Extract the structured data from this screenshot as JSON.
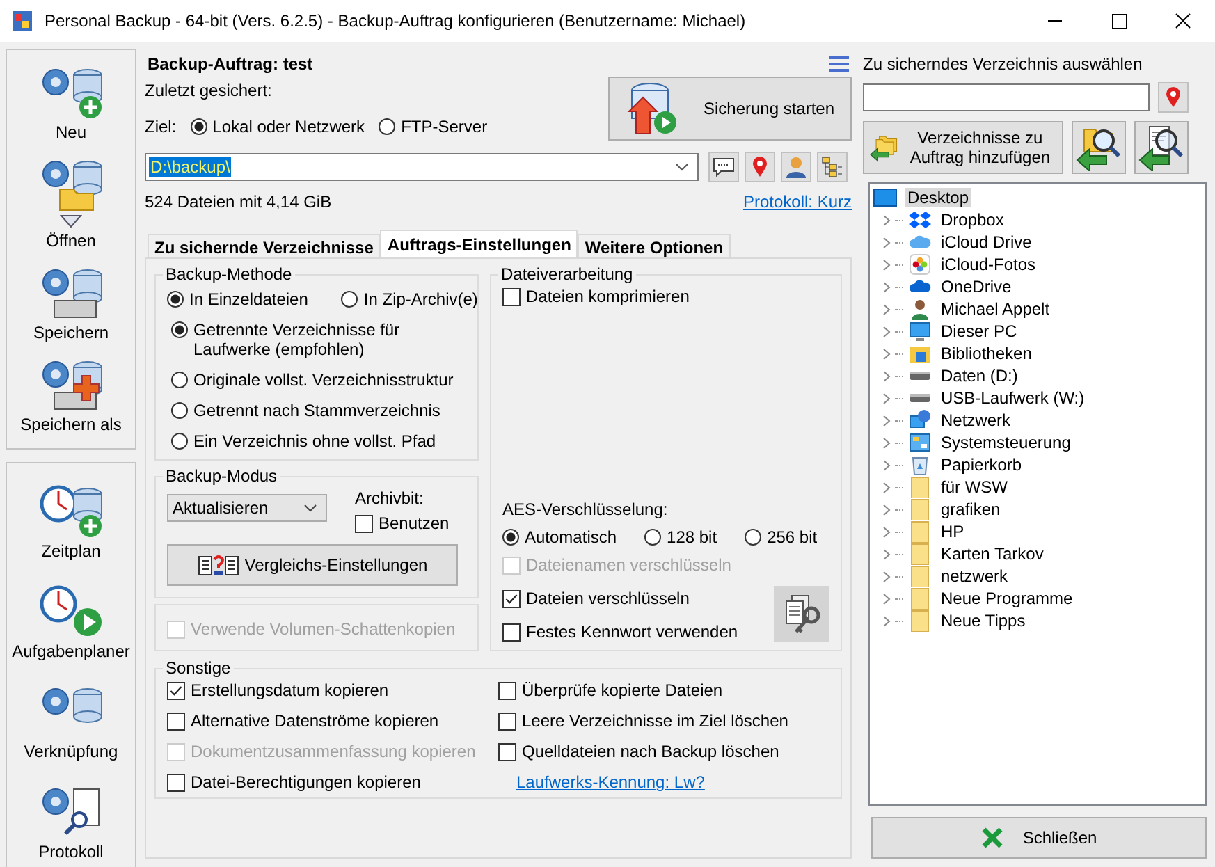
{
  "window": {
    "title": "Personal Backup - 64-bit (Vers. 6.2.5) - Backup-Auftrag konfigurieren (Benutzername: Michael)"
  },
  "sidebar": {
    "groups": [
      [
        {
          "label": "Neu"
        },
        {
          "label": "Öffnen",
          "dropdown": true
        },
        {
          "label": "Speichern"
        },
        {
          "label": "Speichern als"
        }
      ],
      [
        {
          "label": "Zeitplan"
        },
        {
          "label": "Aufgabenplaner"
        },
        {
          "label": "Verknüpfung"
        },
        {
          "label": "Protokoll"
        }
      ]
    ]
  },
  "job": {
    "title": "Backup-Auftrag: test",
    "last_saved": "Zuletzt gesichert:",
    "start_button": "Sicherung starten"
  },
  "target": {
    "label": "Ziel:",
    "options": [
      {
        "label": "Lokal oder Netzwerk",
        "selected": true
      },
      {
        "label": "FTP-Server",
        "selected": false
      }
    ],
    "path": "D:\\backup\\",
    "info": "524 Dateien mit 4,14 GiB",
    "log_link": "Protokoll: Kurz"
  },
  "tabs": [
    {
      "label": "Zu sichernde Verzeichnisse",
      "selected": false
    },
    {
      "label": "Auftrags-Einstellungen",
      "selected": true
    },
    {
      "label": "Weitere Optionen",
      "selected": false
    }
  ],
  "method": {
    "title": "Backup-Methode",
    "format_options": [
      {
        "label": "In Einzeldateien",
        "selected": true
      },
      {
        "label": "In Zip-Archiv(e)",
        "selected": false
      }
    ],
    "structure_options": [
      {
        "label": "Getrennte Verzeichnisse für Laufwerke (empfohlen)",
        "selected": true
      },
      {
        "label": "Originale vollst. Verzeichnisstruktur",
        "selected": false
      },
      {
        "label": "Getrennt nach Stammverzeichnis",
        "selected": false
      },
      {
        "label": "Ein Verzeichnis ohne vollst. Pfad",
        "selected": false
      }
    ]
  },
  "mode": {
    "title": "Backup-Modus",
    "value": "Aktualisieren",
    "archivbit_label": "Archivbit:",
    "archivbit": {
      "label": "Benutzen",
      "checked": false,
      "disabled": false
    },
    "compare_button": "Vergleichs-Einstellungen"
  },
  "shadow_copy": {
    "label": "Verwende Volumen-Schattenkopien",
    "checked": false,
    "disabled": true
  },
  "processing": {
    "title": "Dateiverarbeitung",
    "compress": {
      "label": "Dateien komprimieren",
      "checked": false,
      "disabled": false
    },
    "aes_label": "AES-Verschlüsselung:",
    "aes_options": [
      {
        "label": "Automatisch",
        "selected": true
      },
      {
        "label": "128 bit",
        "selected": false
      },
      {
        "label": "256 bit",
        "selected": false
      }
    ],
    "encryption": [
      {
        "label": "Dateienamen verschlüsseln",
        "checked": false,
        "disabled": true
      },
      {
        "label": "Dateien verschlüsseln",
        "checked": true,
        "disabled": false
      },
      {
        "label": "Festes Kennwort verwenden",
        "checked": false,
        "disabled": false
      }
    ]
  },
  "other": {
    "title": "Sonstige",
    "left": [
      {
        "label": "Erstellungsdatum kopieren",
        "checked": true,
        "disabled": false
      },
      {
        "label": "Alternative Datenströme kopieren",
        "checked": false,
        "disabled": false
      },
      {
        "label": "Dokumentzusammenfassung kopieren",
        "checked": false,
        "disabled": true
      },
      {
        "label": "Datei-Berechtigungen kopieren",
        "checked": false,
        "disabled": false
      }
    ],
    "right": [
      {
        "label": "Überprüfe kopierte Dateien",
        "checked": false,
        "disabled": false
      },
      {
        "label": "Leere Verzeichnisse im Ziel löschen",
        "checked": false,
        "disabled": false
      },
      {
        "label": "Quelldateien nach Backup löschen",
        "checked": false,
        "disabled": false
      }
    ],
    "link": "Laufwerks-Kennung: Lw?"
  },
  "browser": {
    "label": "Zu sicherndes Verzeichnis auswählen",
    "add_button": "Verzeichnisse zu Auftrag hinzufügen",
    "tree": [
      {
        "label": "Desktop",
        "selected": true,
        "children": [
          {
            "label": "Dropbox",
            "selected": false
          },
          {
            "label": "iCloud Drive",
            "selected": false
          },
          {
            "label": "iCloud-Fotos",
            "selected": false
          },
          {
            "label": "OneDrive",
            "selected": false
          },
          {
            "label": "Michael Appelt",
            "selected": false
          },
          {
            "label": "Dieser PC",
            "selected": false
          },
          {
            "label": "Bibliotheken",
            "selected": false
          },
          {
            "label": "Daten (D:)",
            "selected": false
          },
          {
            "label": "USB-Laufwerk (W:)",
            "selected": false
          },
          {
            "label": "Netzwerk",
            "selected": false
          },
          {
            "label": "Systemsteuerung",
            "selected": false
          },
          {
            "label": "Papierkorb",
            "selected": false
          },
          {
            "label": "für WSW",
            "selected": false
          },
          {
            "label": "grafiken",
            "selected": false
          },
          {
            "label": "HP",
            "selected": false
          },
          {
            "label": "Karten Tarkov",
            "selected": false
          },
          {
            "label": "netzwerk",
            "selected": false
          },
          {
            "label": "Neue Programme",
            "selected": false
          },
          {
            "label": "Neue Tipps",
            "selected": false
          }
        ]
      }
    ]
  },
  "close_button": "Schließen"
}
